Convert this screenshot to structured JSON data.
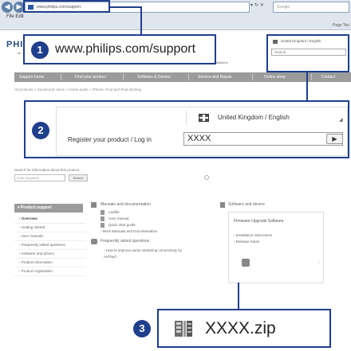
{
  "browser": {
    "address": "www.philips.com/support",
    "search_placeholder": "Google",
    "menu": "File  Edit",
    "toolbar": "Page  Too"
  },
  "page": {
    "logo": "PHI",
    "logo_sub": "se",
    "register_line": "ister installations",
    "nav": [
      "Support home",
      "Find your product",
      "Software & Drivers",
      "Service and Repair",
      "Online shop",
      "Contact"
    ],
    "breadcrumb": "All products > Sound and vision > Home audio > iPhone, iPod and iPad docking",
    "search_info": "Search for information about this product",
    "keyword_placeholder": "Enter keywords",
    "keyword_button": "Search",
    "product_support": "Product support",
    "sidebar": [
      "Overview",
      "Getting started",
      "User manuals",
      "Frequently asked questions",
      "Software and drivers",
      "Product information",
      "Product registration"
    ],
    "docs_head": "Manuals and documentation",
    "docs": [
      "Leaflet",
      "User manual",
      "Quick start guide"
    ],
    "docs_more": "More Manuals and Documentation",
    "faq_head": "Frequently asked questions",
    "faq_items": [
      "How to improve audio streaming connectivity by",
      "AirPlay?"
    ],
    "software_head": "Software and drivers",
    "firmware_title": "Firmware Upgrade Software",
    "firmware_links": [
      "Installation instructions",
      "Release Notes"
    ],
    "region_small": "United Kingdom / English",
    "region_small_input": "Search",
    "region_small_sub": ""
  },
  "callouts": {
    "one": {
      "number": "1",
      "url": "www.philips.com/support"
    },
    "two": {
      "number": "2",
      "language": "United Kingdom / English",
      "register_label": "Register your product / Log in",
      "field_value": "XXXX"
    },
    "three": {
      "number": "3",
      "filename": "XXXX.zip"
    }
  },
  "colors": {
    "callout": "#1f3e8c",
    "nav_bar": "#9b9b9b"
  }
}
